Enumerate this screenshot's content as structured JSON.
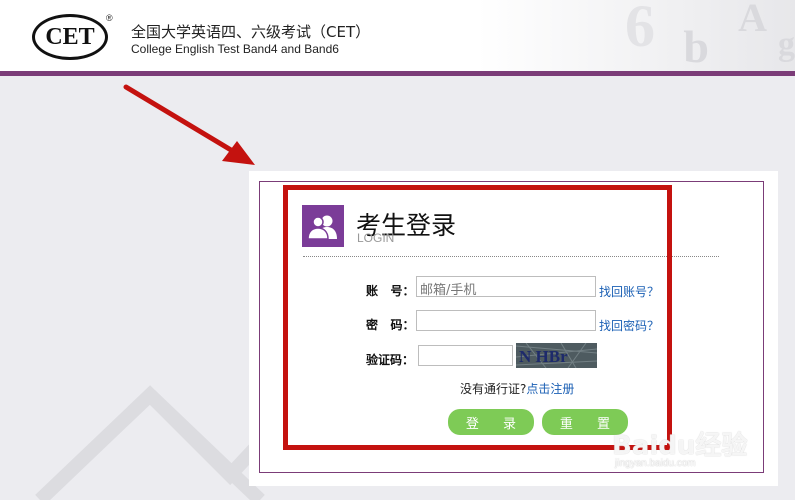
{
  "header": {
    "logo_text": "CET",
    "logo_reg": "®",
    "title_cn": "全国大学英语四、六级考试（CET）",
    "title_en": "College English Test Band4 and Band6"
  },
  "login": {
    "title": "考生登录",
    "subtitle": "LOGIN",
    "account_label": "账   号：",
    "account_placeholder": "邮箱/手机",
    "forgot_account": "找回账号？",
    "password_label": "密   码：",
    "forgot_password": "找回密码？",
    "captcha_label": "验证码：",
    "captcha_text": "N HBr",
    "register_prompt": "没有通行证?",
    "register_link": "点击注册",
    "login_button": "登 录",
    "reset_button": "重 置"
  },
  "watermark": {
    "brand": "Baidu经验",
    "url": "jingyan.baidu.com"
  },
  "colors": {
    "brand_purple": "#7b3c78",
    "button_green": "#7ecb56",
    "annotation_red": "#c4120f",
    "link_blue": "#1a5fb4"
  }
}
